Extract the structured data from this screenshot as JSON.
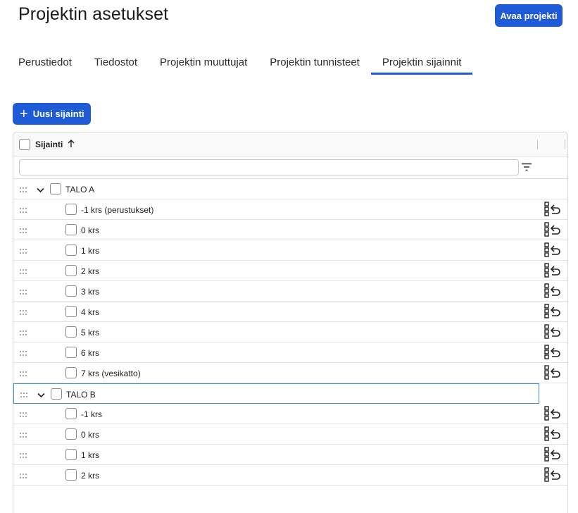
{
  "header": {
    "title": "Projektin asetukset",
    "open_button": "Avaa projekti"
  },
  "tabs": [
    {
      "label": "Perustiedot",
      "active": false
    },
    {
      "label": "Tiedostot",
      "active": false
    },
    {
      "label": "Projektin muuttujat",
      "active": false
    },
    {
      "label": "Projektin tunnisteet",
      "active": false
    },
    {
      "label": "Projektin sijainnit",
      "active": true
    }
  ],
  "toolbar": {
    "new_button": "Uusi sijainti"
  },
  "grid": {
    "column_header": "Sijainti",
    "sort": "ascending",
    "filter_value": "",
    "rows": [
      {
        "type": "group",
        "label": "TALO A",
        "expanded": true
      },
      {
        "type": "child",
        "label": "-1 krs (perustukset)"
      },
      {
        "type": "child",
        "label": "0 krs"
      },
      {
        "type": "child",
        "label": "1 krs"
      },
      {
        "type": "child",
        "label": "2 krs"
      },
      {
        "type": "child",
        "label": "3 krs"
      },
      {
        "type": "child",
        "label": "4 krs"
      },
      {
        "type": "child",
        "label": "5 krs"
      },
      {
        "type": "child",
        "label": "6 krs"
      },
      {
        "type": "child",
        "label": "7 krs (vesikatto)"
      },
      {
        "type": "group",
        "label": "TALO B",
        "expanded": true,
        "selected": true
      },
      {
        "type": "child",
        "label": "-1 krs"
      },
      {
        "type": "child",
        "label": "0 krs"
      },
      {
        "type": "child",
        "label": "1 krs"
      },
      {
        "type": "child",
        "label": "2 krs"
      }
    ]
  },
  "icons": {
    "drag": "drag-handle-icon",
    "expand": "chevron-down-icon",
    "filter": "filter-icon",
    "row_action": "move-location-icon",
    "add": "plus-icon",
    "sort": "arrow-up-icon"
  },
  "colors": {
    "accent": "#1f5bd6",
    "selection_border": "#3b8fd6"
  }
}
